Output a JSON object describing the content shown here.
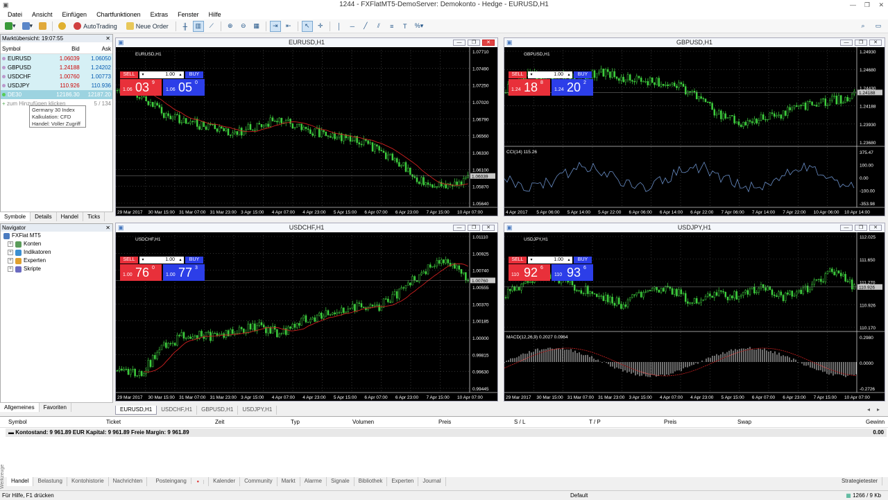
{
  "window": {
    "title": "1244 - FXFlatMT5-DemoServer: Demokonto - Hedge - EURUSD,H1"
  },
  "menu": [
    "Datei",
    "Ansicht",
    "Einfügen",
    "Chartfunktionen",
    "Extras",
    "Fenster",
    "Hilfe"
  ],
  "toolbar": {
    "autotrading": "AutoTrading",
    "new_order": "Neue Order"
  },
  "market_watch": {
    "header": "Marktübersicht: 19:07:55",
    "columns": {
      "symbol": "Symbol",
      "bid": "Bid",
      "ask": "Ask"
    },
    "rows": [
      {
        "symbol": "EURUSD",
        "bid": "1.06039",
        "ask": "1.06050"
      },
      {
        "symbol": "GBPUSD",
        "bid": "1.24188",
        "ask": "1.24202"
      },
      {
        "symbol": "USDCHF",
        "bid": "1.00760",
        "ask": "1.00773"
      },
      {
        "symbol": "USDJPY",
        "bid": "110.926",
        "ask": "110.936"
      },
      {
        "symbol": "DE30",
        "bid": "12186.30",
        "ask": "12187.20"
      }
    ],
    "add_row": "zum Hinzufügen klicken",
    "count": "5 / 134",
    "tooltip": [
      "Germany 30 Index",
      "Kalkulation: CFD",
      "Handel: Voller Zugriff"
    ],
    "tabs": [
      "Symbole",
      "Details",
      "Handel",
      "Ticks"
    ]
  },
  "navigator": {
    "header": "Navigator",
    "root": "FXFlat MT5",
    "items": [
      "Konten",
      "Indikatoren",
      "Experten",
      "Skripte"
    ],
    "tabs": [
      "Allgemeines",
      "Favoriten"
    ]
  },
  "charts": [
    {
      "title": "EURUSD,H1",
      "label": "EURUSD,H1",
      "sell_big": "03",
      "sell_pre": "1.06",
      "sell_sup": "9",
      "buy_big": "05",
      "buy_pre": "1.06",
      "buy_sup": "0",
      "lot": "1.00",
      "yticks": [
        "1.07710",
        "1.07490",
        "1.07250",
        "1.07020",
        "1.06790",
        "1.06560",
        "1.06330",
        "1.06100",
        "1.05870",
        "1.05640"
      ],
      "xticks": [
        "29 Mar 2017",
        "30 Mar 15:00",
        "31 Mar 07:00",
        "31 Mar 23:00",
        "3 Apr 15:00",
        "4 Apr 07:00",
        "4 Apr 23:00",
        "5 Apr 15:00",
        "6 Apr 07:00",
        "6 Apr 23:00",
        "7 Apr 15:00",
        "10 Apr 07:00"
      ],
      "price_tag": "1.06039"
    },
    {
      "title": "GBPUSD,H1",
      "label": "GBPUSD,H1",
      "sell_big": "18",
      "sell_pre": "1.24",
      "sell_sup": "8",
      "buy_big": "20",
      "buy_pre": "1.24",
      "buy_sup": "2",
      "lot": "1.00",
      "yticks": [
        "1.24930",
        "1.24680",
        "1.24430",
        "1.24188",
        "1.23930",
        "1.23680"
      ],
      "indicator": "CCI(14) 115.26",
      "ind_ticks": [
        "375.47",
        "100.00",
        "0.00",
        "-100.00",
        "-353.98"
      ],
      "xticks": [
        "4 Apr 2017",
        "5 Apr 06:00",
        "5 Apr 14:00",
        "5 Apr 22:00",
        "6 Apr 06:00",
        "6 Apr 14:00",
        "6 Apr 22:00",
        "7 Apr 06:00",
        "7 Apr 14:00",
        "7 Apr 22:00",
        "10 Apr 06:00",
        "10 Apr 14:00"
      ],
      "price_tag": "1.24188"
    },
    {
      "title": "USDCHF,H1",
      "label": "USDCHF,H1",
      "sell_big": "76",
      "sell_pre": "1.00",
      "sell_sup": "0",
      "buy_big": "77",
      "buy_pre": "1.00",
      "buy_sup": "3",
      "lot": "1.00",
      "yticks": [
        "1.01110",
        "1.00925",
        "1.00740",
        "1.00555",
        "1.00370",
        "1.00185",
        "1.00000",
        "0.99815",
        "0.99630",
        "0.99445"
      ],
      "xticks": [
        "29 Mar 2017",
        "30 Mar 15:00",
        "31 Mar 07:00",
        "31 Mar 23:00",
        "3 Apr 15:00",
        "4 Apr 07:00",
        "4 Apr 23:00",
        "5 Apr 15:00",
        "6 Apr 07:00",
        "6 Apr 23:00",
        "7 Apr 15:00",
        "10 Apr 07:00"
      ],
      "price_tag": "1.00760"
    },
    {
      "title": "USDJPY,H1",
      "label": "USDJPY,H1",
      "sell_big": "92",
      "sell_pre": "110",
      "sell_sup": "6",
      "buy_big": "93",
      "buy_pre": "110",
      "buy_sup": "6",
      "lot": "1.00",
      "yticks": [
        "112.025",
        "111.650",
        "111.270",
        "110.926",
        "110.170"
      ],
      "indicator": "MACD(12,26,9) 0.2027 0.0964",
      "ind_ticks": [
        "0.2980",
        "0.0000",
        "-0.2726"
      ],
      "xticks": [
        "29 Mar 2017",
        "30 Mar 15:00",
        "31 Mar 07:00",
        "31 Mar 23:00",
        "3 Apr 15:00",
        "4 Apr 07:00",
        "4 Apr 23:00",
        "5 Apr 15:00",
        "6 Apr 07:00",
        "6 Apr 23:00",
        "7 Apr 15:00",
        "10 Apr 07:00"
      ],
      "price_tag": "110.926"
    }
  ],
  "chart_tabs": [
    "EURUSD,H1",
    "USDCHF,H1",
    "GBPUSD,H1",
    "USDJPY,H1"
  ],
  "terminal": {
    "columns": [
      "Symbol",
      "Ticket",
      "Zeit",
      "Typ",
      "Volumen",
      "Preis",
      "S / L",
      "T / P",
      "Preis",
      "Swap",
      "Gewinn"
    ],
    "balance": "Kontostand: 9 961.89 EUR  Kapital: 9 961.89  Freie Margin: 9 961.89",
    "balance_value": "0.00",
    "tabs": [
      "Handel",
      "Belastung",
      "Kontohistorie",
      "Nachrichten",
      "Posteingang",
      "Kalender",
      "Community",
      "Markt",
      "Alarme",
      "Signale",
      "Bibliothek",
      "Experten",
      "Journal"
    ],
    "strategy_tester": "Strategietester",
    "side_label": "Werkzeuge"
  },
  "status": {
    "help": "Für Hilfe, F1 drücken",
    "profile": "Default",
    "traffic": "1266 / 9 Kb"
  },
  "colors": {
    "candle": "#3fd03f",
    "chart_bg": "#000000",
    "sell": "#e8303a",
    "buy": "#2c3ee8",
    "ma": "#d02020"
  }
}
